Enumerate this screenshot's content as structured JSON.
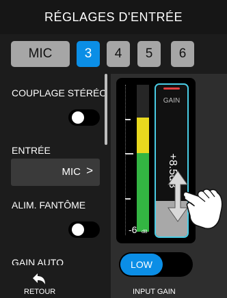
{
  "header": {
    "title": "RÉGLAGES D'ENTRÉE"
  },
  "tabs": [
    {
      "label": "MIC",
      "active": false
    },
    {
      "label": "3",
      "active": true
    },
    {
      "label": "4",
      "active": false
    },
    {
      "label": "5",
      "active": false
    },
    {
      "label": "6",
      "active": false
    }
  ],
  "settings": {
    "stereo_link": {
      "label": "COUPLAGE STÉRÉO",
      "on": false
    },
    "input": {
      "label": "ENTRÉE",
      "value": "MIC",
      "chevron": ">"
    },
    "phantom": {
      "label": "ALIM. FANTÔME",
      "on": false
    },
    "auto_gain": {
      "label": "GAIN AUTO"
    }
  },
  "meter": {
    "db_value": "-6",
    "db_unit": "dB",
    "level_fraction": 0.78
  },
  "gain": {
    "label": "GAIN",
    "value": "+8.5dB",
    "level_fraction": 0.23,
    "input_gain_mode": "LOW",
    "input_gain_label": "INPUT GAIN"
  },
  "footer": {
    "back_label": "RETOUR"
  },
  "colors": {
    "accent": "#0b8ee6",
    "meter_yellow": "#e9d91e",
    "meter_green": "#33b542",
    "slider_border": "#49cde6",
    "peak_red": "#e04040"
  },
  "icons": [
    "back-arrow-icon",
    "up-down-arrows-icon",
    "hand-pointer-icon",
    "chevron-right-icon"
  ]
}
